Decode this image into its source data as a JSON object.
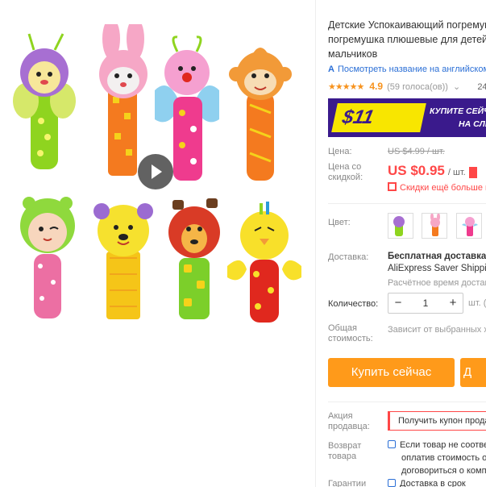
{
  "gallery": {
    "toys": [
      {
        "name": "bee",
        "head": "#a76fd2",
        "handle": "#8fd41f"
      },
      {
        "name": "bunny",
        "head": "#f6a7c6",
        "handle": "#f47a1f"
      },
      {
        "name": "butterfly",
        "head": "#f5a0d0",
        "handle": "#ef3b8e"
      },
      {
        "name": "monkey",
        "head": "#f29a38",
        "handle": "#f47a1f"
      },
      {
        "name": "frog-girl",
        "head": "#8fd93d",
        "handle": "#ec6fa3"
      },
      {
        "name": "bear",
        "head": "#f6e12e",
        "handle": "#f5c518"
      },
      {
        "name": "dog",
        "head": "#d93b26",
        "handle": "#7ccf2a"
      },
      {
        "name": "chick",
        "head": "#f8e02a",
        "handle": "#e0281e"
      }
    ],
    "play_icon": "play-icon"
  },
  "product": {
    "title": "Детские Успокаивающий погремушка ручная погремушка плюшевые для детей для маленьких мальчиков",
    "translate_icon": "А",
    "translate_text": "Посмотреть название на английском",
    "stars": "★★★★★",
    "rating": "4.9",
    "votes": "(59 голоса(ов))",
    "chevron": "⌄",
    "sold": "24"
  },
  "banner": {
    "coupon_amount": "$11",
    "text_line1": "КУПИТЕ СЕЙЧАС",
    "text_line2": "НА СЛЕДУЮЩ"
  },
  "price": {
    "label_price": "Цена:",
    "old_price": "US $4.99 / шт.",
    "label_discount_line1": "Цена со",
    "label_discount_line2": "скидкой:",
    "new_price": "US $0.95",
    "new_unit": "/ шт.",
    "more_discounts": "Скидки ещё больше в приложении"
  },
  "options": {
    "color_label": "Цвет:",
    "thumbs": [
      "#8fd41f",
      "#f6a7c6",
      "#ef3b8e",
      "#f29a38"
    ]
  },
  "shipping": {
    "label": "Доставка:",
    "title": "Бесплатная доставка в Россию",
    "method": "AliExpress Saver Shipping",
    "time": "Расчётное время доставки"
  },
  "quantity": {
    "label": "Количество:",
    "minus": "−",
    "value": "1",
    "plus": "+",
    "unit": "шт. (9"
  },
  "total": {
    "label_line1": "Общая",
    "label_line2": "стоимость:",
    "value": "Зависит от выбранных характеристик"
  },
  "actions": {
    "buy_now": "Купить сейчас",
    "add_to_cart": "Д"
  },
  "seller": {
    "label_line1": "Акция",
    "label_line2": "продавца:",
    "coupon": "Получить купон продавца"
  },
  "returns": {
    "label_line1": "Возврат",
    "label_line2": "товара",
    "line1": "Если товар не соответствует",
    "line2": "оплатив стоимость о",
    "line3": "договориться о компенсации"
  },
  "guarantee": {
    "label": "Гарантии",
    "text": "Доставка в срок"
  },
  "colors": {
    "accent": "#ff4747",
    "buy": "#ff9a1a",
    "link": "#2b6fd6",
    "banner": "#3a1a8c",
    "coupon": "#f8e600"
  }
}
